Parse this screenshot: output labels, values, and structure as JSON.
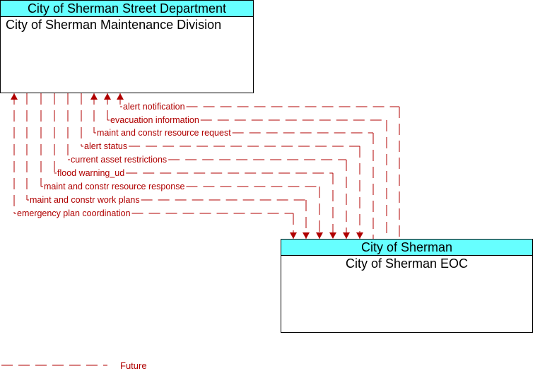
{
  "entities": {
    "maintenance": {
      "header": "City of Sherman Street Department",
      "name": "City of Sherman Maintenance Division"
    },
    "eoc": {
      "header": "City of Sherman",
      "name": "City of Sherman EOC"
    }
  },
  "flows": [
    {
      "label": "alert notification",
      "direction": "to-maintenance",
      "status": "Future"
    },
    {
      "label": "evacuation information",
      "direction": "to-maintenance",
      "status": "Future"
    },
    {
      "label": "maint and constr resource request",
      "direction": "to-maintenance",
      "status": "Future"
    },
    {
      "label": "alert status",
      "direction": "to-eoc",
      "status": "Future"
    },
    {
      "label": "current asset restrictions",
      "direction": "to-eoc",
      "status": "Future"
    },
    {
      "label": "flood warning_ud",
      "direction": "to-eoc",
      "status": "Future"
    },
    {
      "label": "maint and constr resource response",
      "direction": "to-eoc",
      "status": "Future"
    },
    {
      "label": "maint and constr work plans",
      "direction": "to-eoc",
      "status": "Future"
    },
    {
      "label": "emergency plan coordination",
      "direction": "bidirectional",
      "status": "Future"
    }
  ],
  "legend": {
    "label": "Future",
    "color": "#b00000"
  },
  "colors": {
    "flow": "#b00000",
    "header_bg": "#66ffff"
  }
}
